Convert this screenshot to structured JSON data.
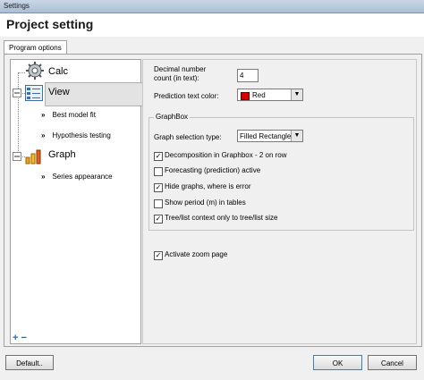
{
  "window": {
    "title": "Settings"
  },
  "header": {
    "title": "Project setting"
  },
  "tabs": [
    {
      "label": "Program options"
    }
  ],
  "tree": {
    "nodes": [
      {
        "label": "Calc",
        "icon": "gear-icon"
      },
      {
        "label": "View",
        "icon": "view-icon",
        "selected": true,
        "children": [
          {
            "label": "Best model fit"
          },
          {
            "label": "Hypothesis testing"
          }
        ]
      },
      {
        "label": "Graph",
        "icon": "bar-chart-icon",
        "children": [
          {
            "label": "Series appearance"
          }
        ]
      }
    ],
    "chevron": "»",
    "add_symbol": "+",
    "remove_symbol": "−"
  },
  "settings": {
    "decimal_label_1": "Decimal number",
    "decimal_label_2": "count (in text):",
    "decimal_value": "4",
    "prediction_color_label": "Prediction text color:",
    "prediction_color_value": "Red",
    "prediction_color_hex": "#d40000",
    "graphbox": {
      "legend": "GraphBox",
      "graph_selection_label": "Graph selection type:",
      "graph_selection_value": "Filled Rectangle",
      "options": [
        {
          "label": "Decomposition in Graphbox - 2 on row",
          "checked": true
        },
        {
          "label": "Forecasting (prediction) active",
          "checked": false
        },
        {
          "label": "Hide graphs, where is error",
          "checked": true
        },
        {
          "label": "Show period (m) in tables",
          "checked": false
        },
        {
          "label": "Tree/list context only to tree/list size",
          "checked": true
        }
      ]
    },
    "zoom": {
      "label": "Activate zoom page",
      "checked": true
    }
  },
  "footer": {
    "default_label": "Default..",
    "ok_label": "OK",
    "cancel_label": "Cancel"
  }
}
